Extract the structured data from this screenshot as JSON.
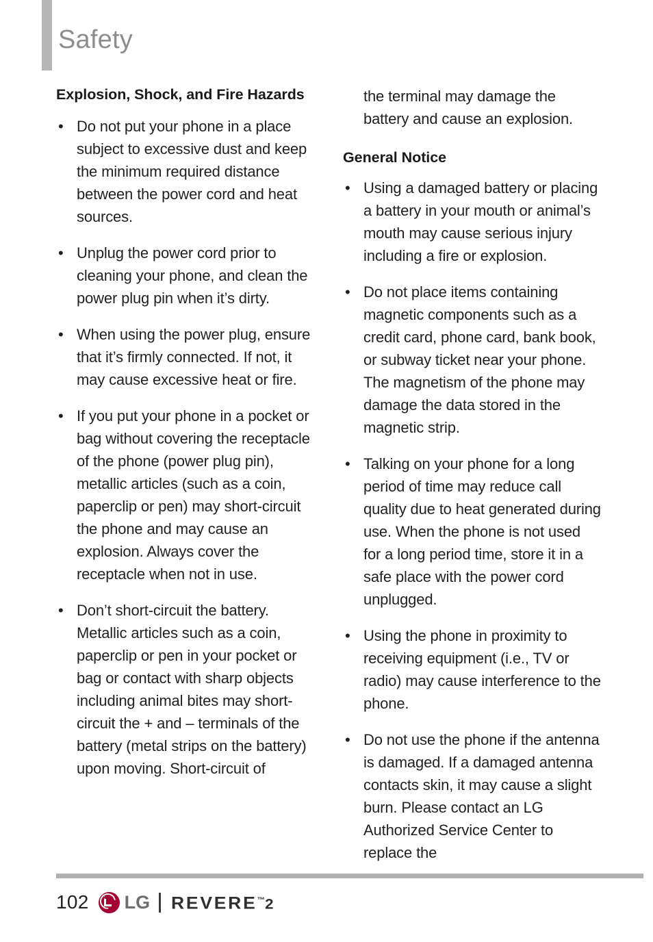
{
  "header": {
    "title": "Safety",
    "accent_color": "#b6b6b6",
    "title_color": "#8d8d8d"
  },
  "columns": {
    "left": {
      "heading": "Explosion, Shock, and Fire Hazards",
      "bullets": [
        "Do not put your phone in a place subject to excessive dust and keep the minimum required distance between the power cord and heat sources.",
        "Unplug the power cord prior to cleaning your phone, and clean the power plug pin when it’s dirty.",
        "When using the power plug, ensure that it’s firmly connected. If not, it may cause excessive heat or fire.",
        "If you put your phone in a pocket or bag without covering the receptacle of the phone (power plug pin), metallic articles (such as a coin, paperclip or pen) may short-circuit the phone and may cause an explosion. Always cover the receptacle when not in use.",
        "Don’t short-circuit the battery. Metallic articles such as a coin, paperclip or pen in your pocket or bag or contact with sharp objects including animal bites may short-circuit the + and – terminals of the battery (metal strips on the battery) upon moving. Short-circuit of"
      ]
    },
    "right": {
      "continued_text": "the terminal may damage the battery and cause an explosion.",
      "heading": "General Notice",
      "bullets": [
        "Using a damaged battery or placing a battery in your mouth or animal’s mouth may cause serious injury including a fire or explosion.",
        "Do not place items containing magnetic components such as a credit card, phone card, bank book, or subway ticket near your phone. The magnetism of the phone may damage the data stored in the magnetic strip.",
        "Talking on your phone for a long period of time may reduce call quality due to heat generated during use. When the phone is not used for a long period time, store it in a safe place with the power cord unplugged.",
        "Using the phone in proximity to receiving equipment (i.e., TV or radio) may cause interference to the phone.",
        "Do not use the phone if the antenna is damaged. If a damaged antenna contacts skin, it may cause a slight burn. Please contact an LG Authorized Service Center to replace the"
      ]
    }
  },
  "bullet_glyph": "•",
  "footer": {
    "page_number": "102",
    "brand_wordmark": "LG",
    "brand_logo_icon": "lg-circle-logo-icon",
    "product_name": "REVERE",
    "product_trademark": "™",
    "product_version": "2",
    "logo_color": "#a50034",
    "rule_color": "#b0b0b0"
  }
}
